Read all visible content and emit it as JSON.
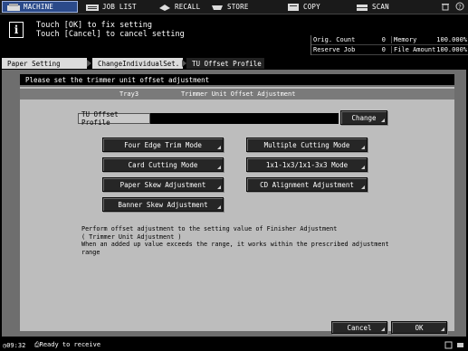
{
  "tabs": [
    {
      "label": "MACHINE",
      "icon": "machine-icon",
      "active": true
    },
    {
      "label": "JOB LIST",
      "icon": "job-list-icon"
    },
    {
      "label": "RECALL",
      "icon": "recall-icon"
    },
    {
      "label": "STORE",
      "icon": "store-icon"
    },
    {
      "label": "COPY",
      "icon": "copy-icon"
    },
    {
      "label": "SCAN",
      "icon": "scan-icon"
    }
  ],
  "message": {
    "line1": "Touch [OK] to fix setting",
    "line2": "Touch [Cancel] to cancel setting"
  },
  "counters": {
    "orig_count_label": "Orig. Count",
    "orig_count_value": "0",
    "memory_label": "Memory",
    "memory_value": "100.000%",
    "reserve_job_label": "Reserve Job",
    "reserve_job_value": "0",
    "file_amount_label": "File Amount",
    "file_amount_value": "100.000%"
  },
  "breadcrumb": [
    "Paper Setting",
    "ChangeIndividualSet.",
    "TU Offset Profile"
  ],
  "subheader": "Please set the trimmer unit offset adjustment",
  "tray_bar": {
    "tray": "Tray3",
    "title": "Trimmer Unit Offset Adjustment"
  },
  "profile": {
    "label": "TU Offset Profile",
    "value": "",
    "change_label": "Change"
  },
  "buttons": {
    "four_edge": "Four Edge Trim Mode",
    "card_cutting": "Card Cutting Mode",
    "paper_skew": "Paper Skew Adjustment",
    "banner_skew": "Banner Skew Adjustment",
    "multiple_cutting": "Multiple Cutting Mode",
    "one_by_one": "1x1-1x3/1x1-3x3 Mode",
    "cd_alignment": "CD Alignment Adjustment"
  },
  "note": "Perform offset adjustment to the setting value of Finisher Adjustment\n( Trimmer Unit Adjustment )\nWhen an added up value exceeds the range, it works within the prescribed adjustment\nrange",
  "actions": {
    "cancel": "Cancel",
    "ok": "OK"
  },
  "status": {
    "time": "09:32",
    "job": "Ready to receive"
  }
}
